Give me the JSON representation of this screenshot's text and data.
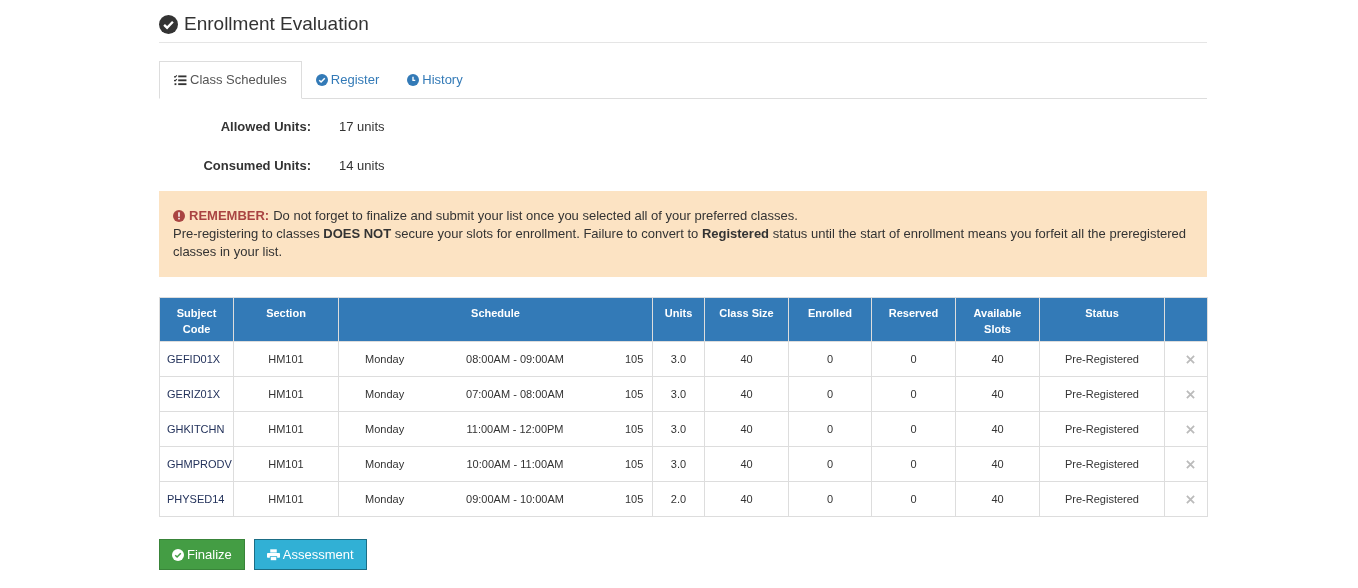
{
  "title": "Enrollment Evaluation",
  "tabs": [
    {
      "label": "Class Schedules",
      "kind": "list",
      "selected": true
    },
    {
      "label": "Register",
      "kind": "check",
      "selected": false
    },
    {
      "label": "History",
      "kind": "clock",
      "selected": false
    }
  ],
  "units": [
    {
      "label": "Allowed Units:",
      "value": "17 units"
    },
    {
      "label": "Consumed Units:",
      "value": "14 units"
    }
  ],
  "alert": {
    "label": "REMEMBER:",
    "message": "Do not forget to finalize and submit your list once you selected all of your preferred classes.",
    "details": "Pre-registering to classes **DOES NOT** secure your slots for enrollment. Failure to convert to **Registered** status until the start of enrollment means you forfeit all the preregistered classes in your list."
  },
  "table": {
    "columns": [
      "Subject Code",
      "Section",
      "Schedule",
      "Units",
      "Class Size",
      "Enrolled",
      "Reserved",
      "Available Slots",
      "Status"
    ],
    "rows": [
      {
        "code": "GEFID01X",
        "section": "HM101",
        "day": "Monday",
        "time": "08:00AM - 09:00AM",
        "room": "105",
        "units": "3.0",
        "class_size": "40",
        "enrolled": "0",
        "reserved": "0",
        "available": "40",
        "status": "Pre-Registered"
      },
      {
        "code": "GERIZ01X",
        "section": "HM101",
        "day": "Monday",
        "time": "07:00AM - 08:00AM",
        "room": "105",
        "units": "3.0",
        "class_size": "40",
        "enrolled": "0",
        "reserved": "0",
        "available": "40",
        "status": "Pre-Registered"
      },
      {
        "code": "GHKITCHN",
        "section": "HM101",
        "day": "Monday",
        "time": "11:00AM - 12:00PM",
        "room": "105",
        "units": "3.0",
        "class_size": "40",
        "enrolled": "0",
        "reserved": "0",
        "available": "40",
        "status": "Pre-Registered"
      },
      {
        "code": "GHMPRODV",
        "section": "HM101",
        "day": "Monday",
        "time": "10:00AM - 11:00AM",
        "room": "105",
        "units": "3.0",
        "class_size": "40",
        "enrolled": "0",
        "reserved": "0",
        "available": "40",
        "status": "Pre-Registered"
      },
      {
        "code": "PHYSED14",
        "section": "HM101",
        "day": "Monday",
        "time": "09:00AM - 10:00AM",
        "room": "105",
        "units": "2.0",
        "class_size": "40",
        "enrolled": "0",
        "reserved": "0",
        "available": "40",
        "status": "Pre-Registered"
      }
    ]
  },
  "buttons": [
    {
      "label": "Finalize",
      "kind": "success"
    },
    {
      "label": "Assessment",
      "kind": "info"
    }
  ]
}
